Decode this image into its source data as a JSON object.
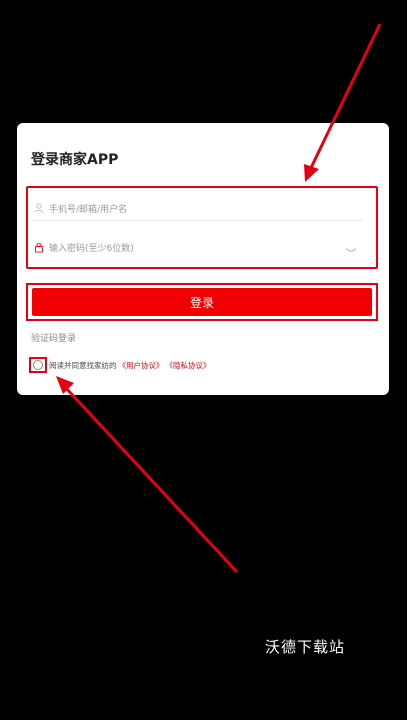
{
  "login": {
    "title": "登录商家APP",
    "username_placeholder": "手机号/邮箱/用户名",
    "password_placeholder": "输入密码(至少6位数)",
    "submit_label": "登录",
    "code_login_label": "验证码登录",
    "agreement_prefix": "阅读并同意找家纺的",
    "user_agreement": "《用户协议》",
    "privacy_agreement": "《隐私协议》"
  },
  "watermark": "沃德下载站",
  "colors": {
    "background": "#000000",
    "card": "#ffffff",
    "accent": "#e60012",
    "button": "#f00000"
  },
  "icons": {
    "username": "user-icon",
    "password": "lock-icon",
    "visibility": "eye-closed-icon"
  }
}
